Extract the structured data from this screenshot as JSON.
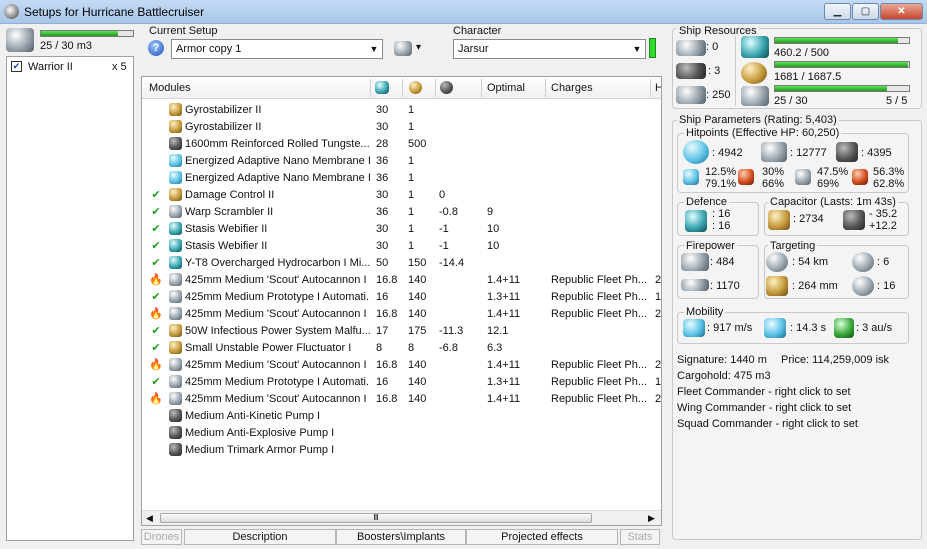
{
  "window": {
    "title": "Setups for Hurricane Battlecruiser",
    "min_label": "▁",
    "max_label": "▢",
    "close_label": "✕"
  },
  "drone_bay": {
    "bandwidth": "25 / 30 m3",
    "bandwidth_fraction": 0.833,
    "items": [
      {
        "name": "Warrior II",
        "count": "x 5",
        "checked": true
      }
    ]
  },
  "setup": {
    "label": "Current Setup",
    "value": "Armor copy 1",
    "help": "?",
    "drone_btn": "▾"
  },
  "character": {
    "label": "Character",
    "value": "Jarsur"
  },
  "modules": {
    "headers": {
      "name": "Modules",
      "c1": "",
      "c2": "",
      "c3": "",
      "optimal": "Optimal",
      "charges": "Charges",
      "extra": "H"
    },
    "rows": [
      {
        "status": "",
        "icon": "gyro",
        "name": "Gyrostabilizer II",
        "c1": "30",
        "c2": "1",
        "c3": "",
        "optimal": "",
        "charges": "",
        "extra": ""
      },
      {
        "status": "",
        "icon": "gyro",
        "name": "Gyrostabilizer II",
        "c1": "30",
        "c2": "1",
        "c3": "",
        "optimal": "",
        "charges": "",
        "extra": ""
      },
      {
        "status": "",
        "icon": "plate",
        "name": "1600mm Reinforced Rolled Tungste...",
        "c1": "28",
        "c2": "500",
        "c3": "",
        "optimal": "",
        "charges": "",
        "extra": ""
      },
      {
        "status": "",
        "icon": "membrane",
        "name": "Energized Adaptive Nano Membrane II",
        "c1": "36",
        "c2": "1",
        "c3": "",
        "optimal": "",
        "charges": "",
        "extra": ""
      },
      {
        "status": "",
        "icon": "membrane",
        "name": "Energized Adaptive Nano Membrane II",
        "c1": "36",
        "c2": "1",
        "c3": "",
        "optimal": "",
        "charges": "",
        "extra": ""
      },
      {
        "status": "✔",
        "icon": "dc",
        "name": "Damage Control II",
        "c1": "30",
        "c2": "1",
        "c3": "0",
        "optimal": "",
        "charges": "",
        "extra": ""
      },
      {
        "status": "✔",
        "icon": "scram",
        "name": "Warp Scrambler II",
        "c1": "36",
        "c2": "1",
        "c3": "-0.8",
        "optimal": "9",
        "charges": "",
        "extra": ""
      },
      {
        "status": "✔",
        "icon": "web",
        "name": "Stasis Webifier II",
        "c1": "30",
        "c2": "1",
        "c3": "-1",
        "optimal": "10",
        "charges": "",
        "extra": ""
      },
      {
        "status": "✔",
        "icon": "web",
        "name": "Stasis Webifier II",
        "c1": "30",
        "c2": "1",
        "c3": "-1",
        "optimal": "10",
        "charges": "",
        "extra": ""
      },
      {
        "status": "✔",
        "icon": "ab",
        "name": "Y-T8 Overcharged Hydrocarbon I Mi...",
        "c1": "50",
        "c2": "150",
        "c3": "-14.4",
        "optimal": "",
        "charges": "",
        "extra": ""
      },
      {
        "status": "🔥",
        "icon": "gun",
        "name": "425mm Medium 'Scout' Autocannon I",
        "c1": "16.8",
        "c2": "140",
        "c3": "",
        "optimal": "1.4+11",
        "charges": "Republic Fleet Ph...",
        "extra": "2"
      },
      {
        "status": "✔",
        "icon": "gun",
        "name": "425mm Medium Prototype I Automati...",
        "c1": "16",
        "c2": "140",
        "c3": "",
        "optimal": "1.3+11",
        "charges": "Republic Fleet Ph...",
        "extra": "1"
      },
      {
        "status": "🔥",
        "icon": "gun",
        "name": "425mm Medium 'Scout' Autocannon I",
        "c1": "16.8",
        "c2": "140",
        "c3": "",
        "optimal": "1.4+11",
        "charges": "Republic Fleet Ph...",
        "extra": "2"
      },
      {
        "status": "✔",
        "icon": "neut",
        "name": "50W Infectious Power System Malfu...",
        "c1": "17",
        "c2": "175",
        "c3": "-11.3",
        "optimal": "12.1",
        "charges": "",
        "extra": ""
      },
      {
        "status": "✔",
        "icon": "neut",
        "name": "Small Unstable Power Fluctuator I",
        "c1": "8",
        "c2": "8",
        "c3": "-6.8",
        "optimal": "6.3",
        "charges": "",
        "extra": ""
      },
      {
        "status": "🔥",
        "icon": "gun",
        "name": "425mm Medium 'Scout' Autocannon I",
        "c1": "16.8",
        "c2": "140",
        "c3": "",
        "optimal": "1.4+11",
        "charges": "Republic Fleet Ph...",
        "extra": "2"
      },
      {
        "status": "✔",
        "icon": "gun",
        "name": "425mm Medium Prototype I Automati...",
        "c1": "16",
        "c2": "140",
        "c3": "",
        "optimal": "1.3+11",
        "charges": "Republic Fleet Ph...",
        "extra": "1"
      },
      {
        "status": "🔥",
        "icon": "gun",
        "name": "425mm Medium 'Scout' Autocannon I",
        "c1": "16.8",
        "c2": "140",
        "c3": "",
        "optimal": "1.4+11",
        "charges": "Republic Fleet Ph...",
        "extra": "2"
      },
      {
        "status": "",
        "icon": "rig",
        "name": "Medium Anti-Kinetic Pump I",
        "c1": "",
        "c2": "",
        "c3": "",
        "optimal": "",
        "charges": "",
        "extra": ""
      },
      {
        "status": "",
        "icon": "rig",
        "name": "Medium Anti-Explosive Pump I",
        "c1": "",
        "c2": "",
        "c3": "",
        "optimal": "",
        "charges": "",
        "extra": ""
      },
      {
        "status": "",
        "icon": "rig",
        "name": "Medium Trimark Armor Pump I",
        "c1": "",
        "c2": "",
        "c3": "",
        "optimal": "",
        "charges": "",
        "extra": ""
      }
    ],
    "scroll_thumb": "Ⅲ"
  },
  "bottom_tabs": {
    "drones": "Drones",
    "description": "Description",
    "boosters": "Boosters\\Implants",
    "projected": "Projected effects",
    "stats": "Stats"
  },
  "resources": {
    "title": "Ship Resources",
    "turret": ": 0",
    "launcher": ": 3",
    "calib": ": 250",
    "cpu": "460.2 / 500",
    "cpu_fraction": 0.92,
    "pg": "1681 / 1687.5",
    "pg_fraction": 0.996,
    "drone_bw": "25 / 30",
    "drone_bw_fraction": 0.833,
    "drones_active": "5 / 5"
  },
  "params": {
    "title": "Ship Parameters (Rating: 5,403)",
    "hp_title": "Hitpoints (Effective HP: 60,250)",
    "shield": ": 4942",
    "armor": ": 12777",
    "hull": ": 4395",
    "res1a": "12.5%",
    "res1b": "79.1%",
    "res2a": "30%",
    "res2b": "66%",
    "res3a": "47.5%",
    "res3b": "69%",
    "res4a": "56.3%",
    "res4b": "62.8%",
    "defence_title": "Defence",
    "def1": ": 16",
    "def2": ": 16",
    "cap_title": "Capacitor (Lasts: 1m 43s)",
    "cap_amount": ": 2734",
    "cap_use": "- 35.2",
    "cap_regen": "+12.2",
    "fire_title": "Firepower",
    "dps": ": 484",
    "volley": ": 1170",
    "target_title": "Targeting",
    "range": ": 54 km",
    "max_targets": ": 6",
    "scan": ": 264 mm",
    "sensor": ": 16",
    "mob_title": "Mobility",
    "speed": ": 917 m/s",
    "align": ": 14.3 s",
    "warp": ": 3 au/s",
    "signature": "Signature: 1440 m",
    "price": "Price: 114,259,009 isk",
    "cargo": "Cargohold: 475 m3",
    "fleet": "Fleet Commander - right click to set",
    "wing": "Wing Commander - right click to set",
    "squad": "Squad Commander - right click to set"
  }
}
